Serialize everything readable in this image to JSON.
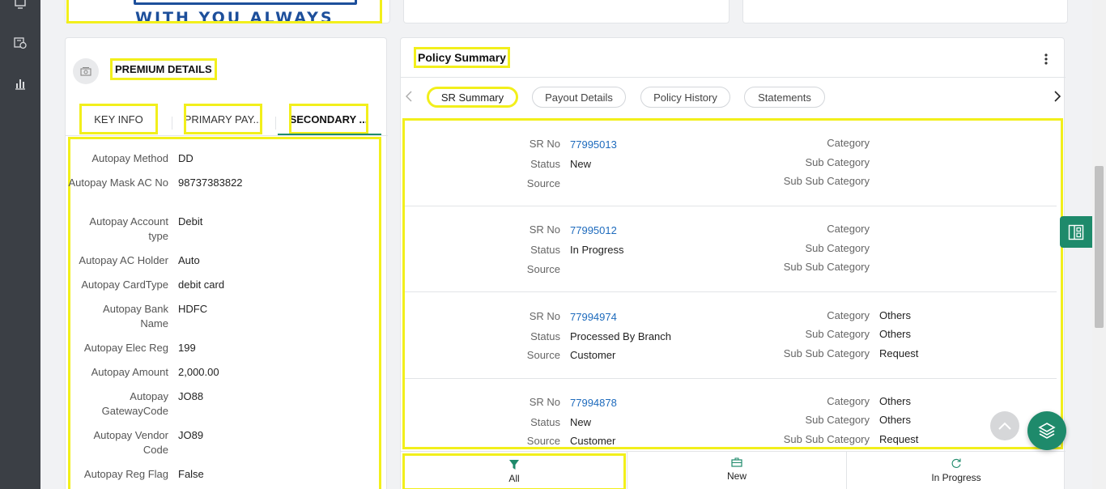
{
  "brand": {
    "logo_text": "WITH YOU ALWAYS"
  },
  "colors": {
    "accent": "#1e8a6b",
    "highlight": "#f2ef1b",
    "link": "#1e6bbd",
    "sidebar": "#3b3f45"
  },
  "sidebar": {
    "icons": [
      "monitor-icon",
      "calendar-refresh-icon",
      "bar-chart-icon"
    ]
  },
  "premium": {
    "title": "PREMIUM DETAILS",
    "tabs": [
      {
        "label": "KEY INFO"
      },
      {
        "label": "PRIMARY PAY..."
      },
      {
        "label": "SECONDARY ..."
      }
    ],
    "active_tab": "SECONDARY ...",
    "fields": [
      {
        "label": "Autopay Method",
        "value": "DD"
      },
      {
        "label": "Autopay Mask AC No",
        "value": "98737383822"
      },
      {
        "label": "Autopay Account type",
        "value": "Debit"
      },
      {
        "label": "Autopay AC Holder",
        "value": "Auto"
      },
      {
        "label": "Autopay CardType",
        "value": "debit card"
      },
      {
        "label": "Autopay Bank Name",
        "value": "HDFC"
      },
      {
        "label": "Autopay Elec Reg",
        "value": "199"
      },
      {
        "label": "Autopay Amount",
        "value": "2,000.00"
      },
      {
        "label": "Autopay GatewayCode",
        "value": "JO88"
      },
      {
        "label": "Autopay Vendor Code",
        "value": "JO89"
      },
      {
        "label": "Autopay Reg Flag",
        "value": "False"
      }
    ]
  },
  "policy": {
    "title": "Policy Summary",
    "tabs": [
      {
        "label": "SR Summary"
      },
      {
        "label": "Payout Details"
      },
      {
        "label": "Policy History"
      },
      {
        "label": "Statements"
      }
    ],
    "active_tab": "SR Summary",
    "labels": {
      "sr_no": "SR No",
      "status": "Status",
      "source": "Source",
      "category": "Category",
      "sub_category": "Sub Category",
      "sub_sub_category": "Sub Sub Category"
    },
    "requests": [
      {
        "sr_no": "77995013",
        "status": "New",
        "source": "",
        "category": "",
        "sub_category": "",
        "sub_sub_category": ""
      },
      {
        "sr_no": "77995012",
        "status": "In Progress",
        "source": "",
        "category": "",
        "sub_category": "",
        "sub_sub_category": ""
      },
      {
        "sr_no": "77994974",
        "status": "Processed By Branch",
        "source": "Customer",
        "category": "Others",
        "sub_category": "Others",
        "sub_sub_category": "Request"
      },
      {
        "sr_no": "77994878",
        "status": "New",
        "source": "Customer",
        "category": "Others",
        "sub_category": "Others",
        "sub_sub_category": "Request"
      }
    ],
    "filters": [
      {
        "label": "All",
        "icon": "filter-icon"
      },
      {
        "label": "New",
        "icon": "briefcase-icon"
      },
      {
        "label": "In Progress",
        "icon": "refresh-icon"
      }
    ]
  }
}
